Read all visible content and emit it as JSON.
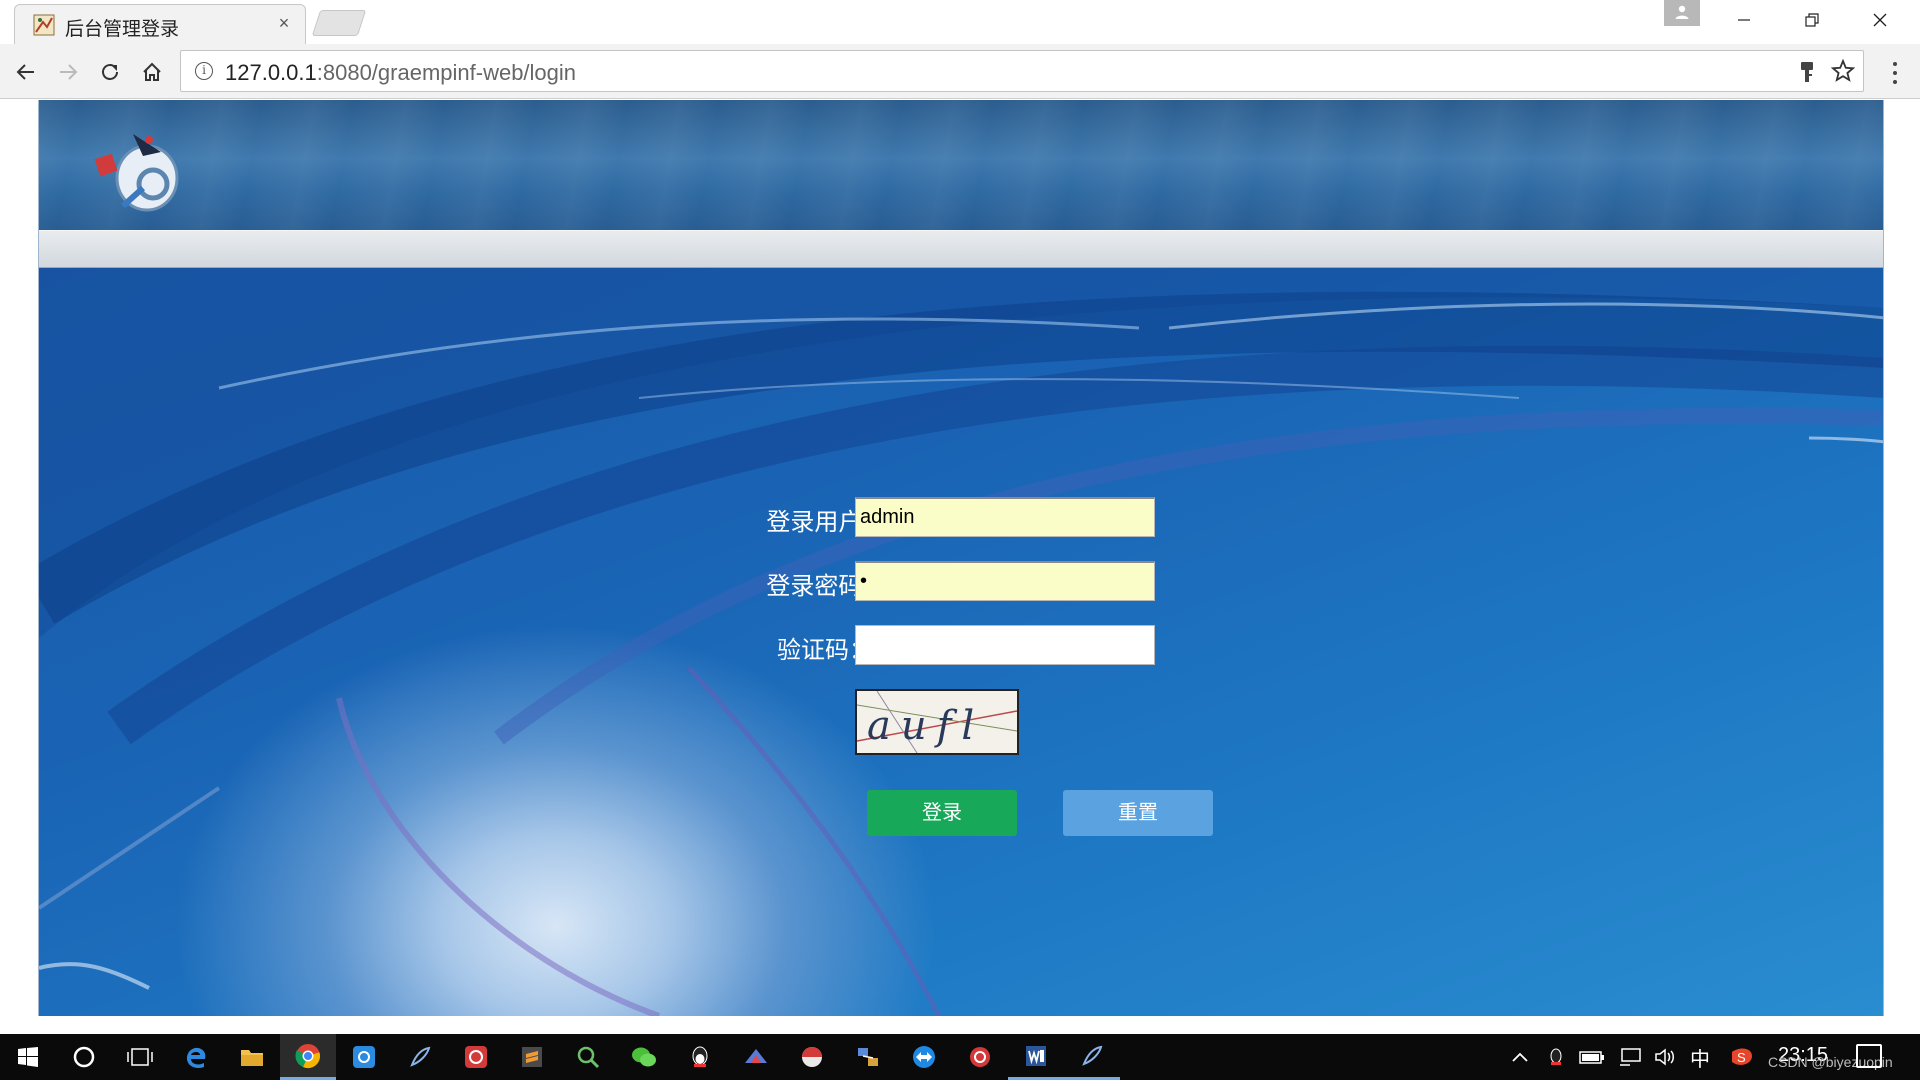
{
  "browser": {
    "tab_title": "后台管理登录",
    "tab_close": "×",
    "url_host": "127.0.0.1",
    "url_rest": ":8080/graempinf-web/login"
  },
  "login_form": {
    "user_label": "登录用户:",
    "user_value": "admin",
    "password_label": "登录密码:",
    "password_value": "•",
    "code_label": "验证码：",
    "code_value": "",
    "captcha_text": "aufl",
    "login_button": "登录",
    "reset_button": "重置"
  },
  "taskbar": {
    "ime_indicator": "中",
    "clock": "23:15",
    "watermark": "CSDN @biyezuopin"
  },
  "colors": {
    "login_button": "#17a85a",
    "reset_button": "#5aa3e0",
    "autofill_field": "#fbfdc8"
  }
}
